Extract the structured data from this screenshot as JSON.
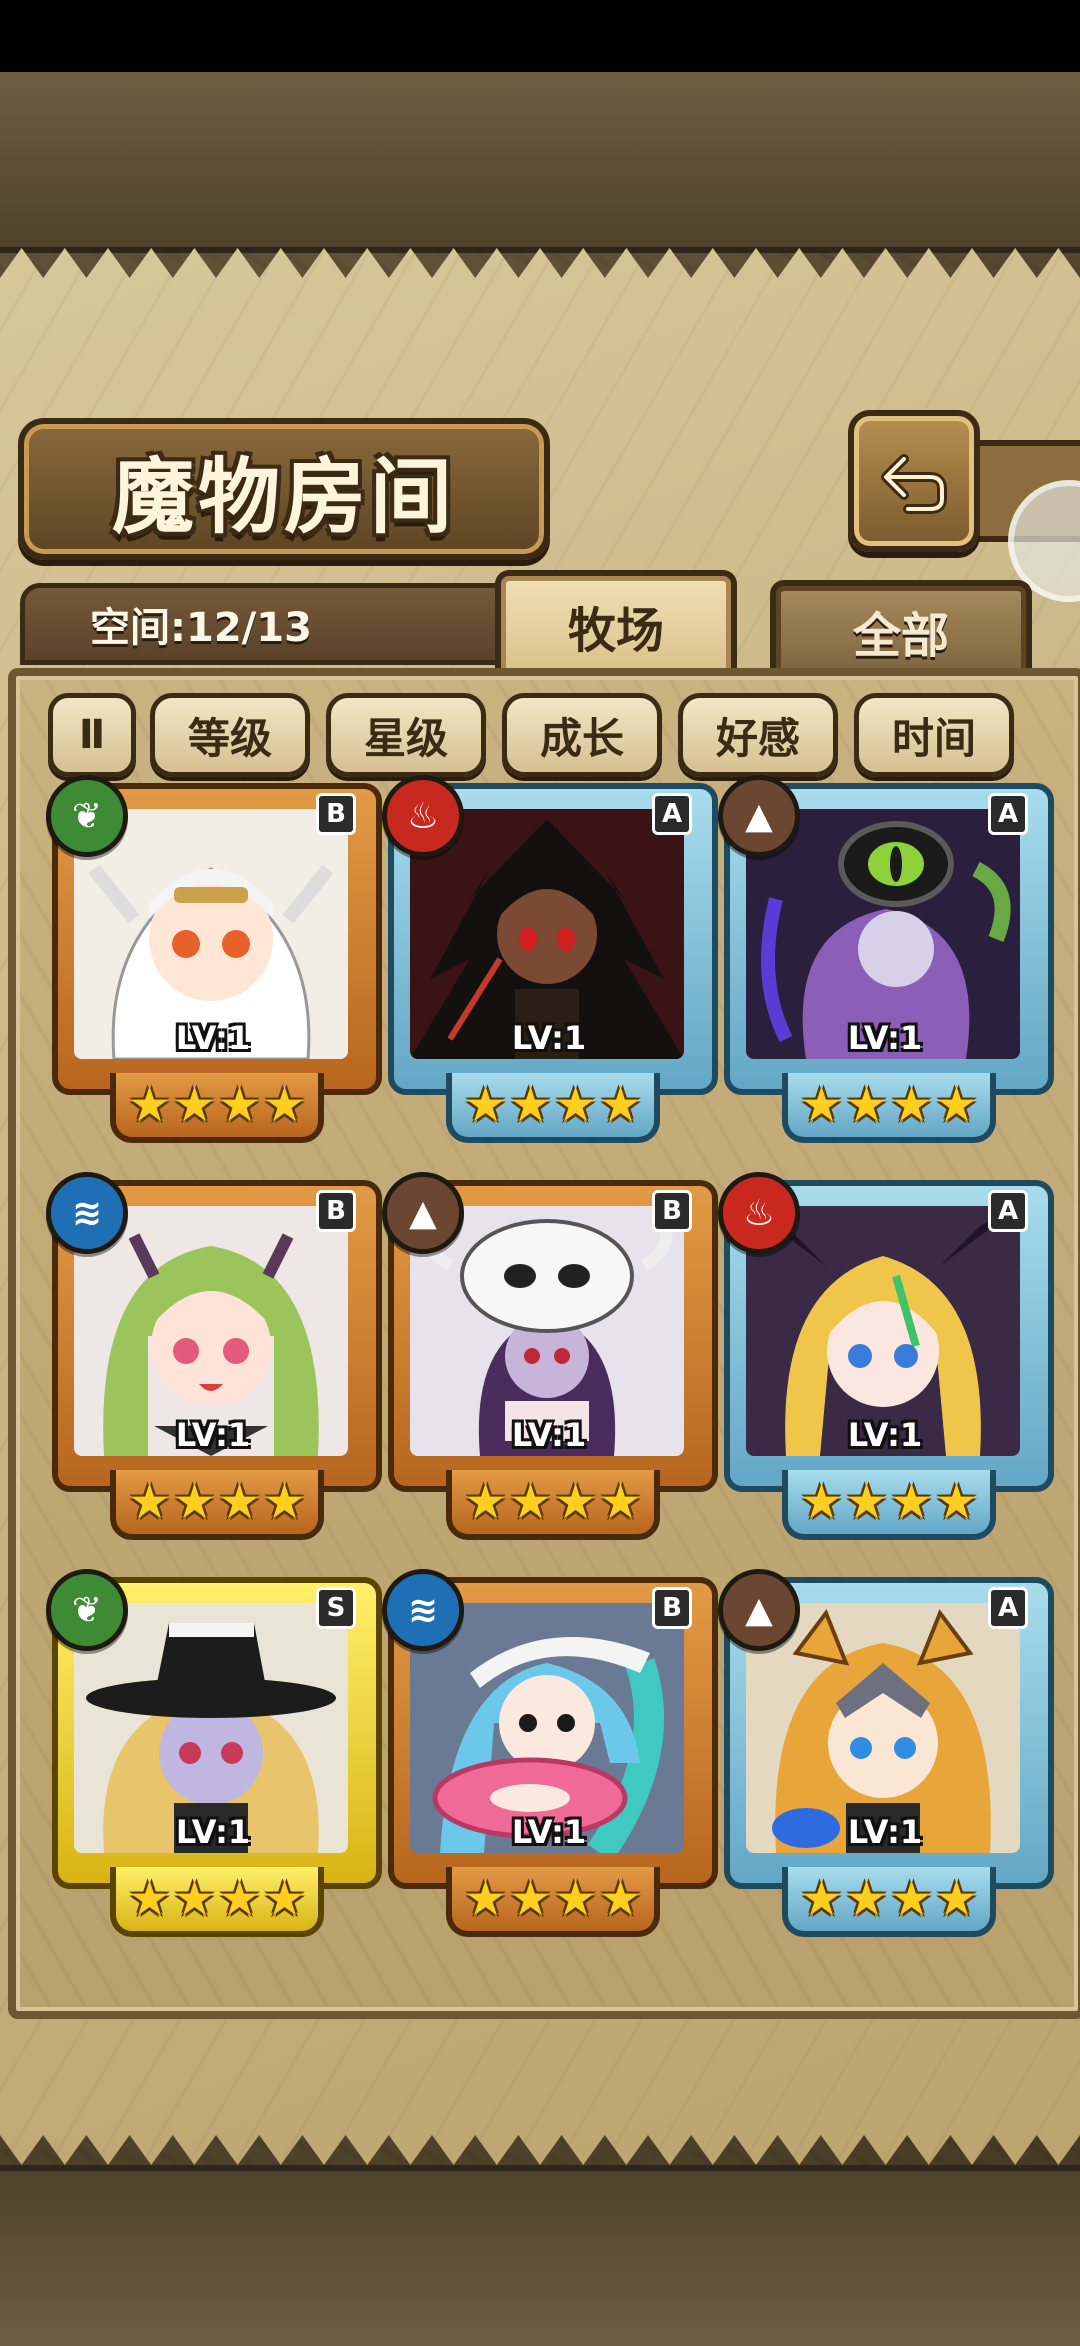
{
  "title": "魔物房间",
  "space": "空间:12/13",
  "tabs": {
    "pasture": "牧场",
    "all": "全部"
  },
  "filters": {
    "pause_symbol": "Ⅱ",
    "items": [
      "等级",
      "星级",
      "成长",
      "好感",
      "时间"
    ]
  },
  "monsters": [
    {
      "rarity": "B",
      "element": "grass-icon",
      "level_text": "LV:1",
      "stars": 4,
      "frame": "orange",
      "art": "white-haired-angel"
    },
    {
      "rarity": "A",
      "element": "fire-icon",
      "level_text": "LV:1",
      "stars": 4,
      "frame": "blue",
      "art": "dark-spiky-warrior"
    },
    {
      "rarity": "A",
      "element": "earth-icon",
      "level_text": "LV:1",
      "stars": 4,
      "frame": "blue",
      "art": "purple-eye-witch"
    },
    {
      "rarity": "B",
      "element": "water-icon",
      "level_text": "LV:1",
      "stars": 4,
      "frame": "orange",
      "art": "green-haired-elf"
    },
    {
      "rarity": "B",
      "element": "earth-icon",
      "level_text": "LV:1",
      "stars": 4,
      "frame": "orange",
      "art": "skull-hat-girl"
    },
    {
      "rarity": "A",
      "element": "fire-icon",
      "level_text": "LV:1",
      "stars": 4,
      "frame": "blue",
      "art": "blonde-bat-girl"
    },
    {
      "rarity": "S",
      "element": "grass-icon",
      "level_text": "LV:1",
      "stars": 4,
      "frame": "gold",
      "art": "witch-hat-girl"
    },
    {
      "rarity": "B",
      "element": "water-icon",
      "level_text": "LV:1",
      "stars": 4,
      "frame": "orange",
      "art": "blue-haired-float-girl"
    },
    {
      "rarity": "A",
      "element": "earth-icon",
      "level_text": "LV:1",
      "stars": 4,
      "frame": "blue",
      "art": "cat-eared-knight"
    }
  ],
  "colors": {
    "parchment": "#c9b584",
    "frame_orange": "#e29a45",
    "frame_blue": "#a8dcec",
    "frame_gold": "#fff06a",
    "star": "#ffcf1f"
  }
}
